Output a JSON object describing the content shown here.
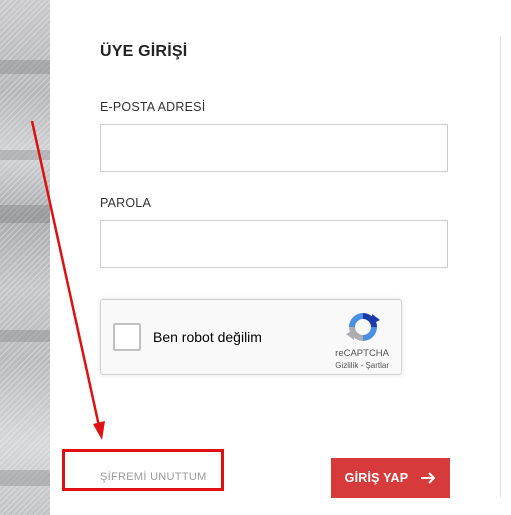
{
  "form": {
    "title": "ÜYE GİRİŞİ",
    "email_label": "E-POSTA ADRESİ",
    "email_value": "",
    "password_label": "PAROLA",
    "password_value": ""
  },
  "recaptcha": {
    "checkbox_label": "Ben robot değilim",
    "brand": "reCAPTCHA",
    "privacy_link": "Gizlilik",
    "separator": " - ",
    "terms_link": "Şartlar"
  },
  "actions": {
    "forgot_password": "ŞİFREMİ UNUTTUM",
    "login_button": "GİRİŞ YAP"
  },
  "icons": {
    "recaptcha_logo": "recaptcha-logo-icon",
    "login_arrow": "arrow-right-icon"
  },
  "colors": {
    "primary_button": "#d63a3a",
    "annotation": "#e01010"
  }
}
